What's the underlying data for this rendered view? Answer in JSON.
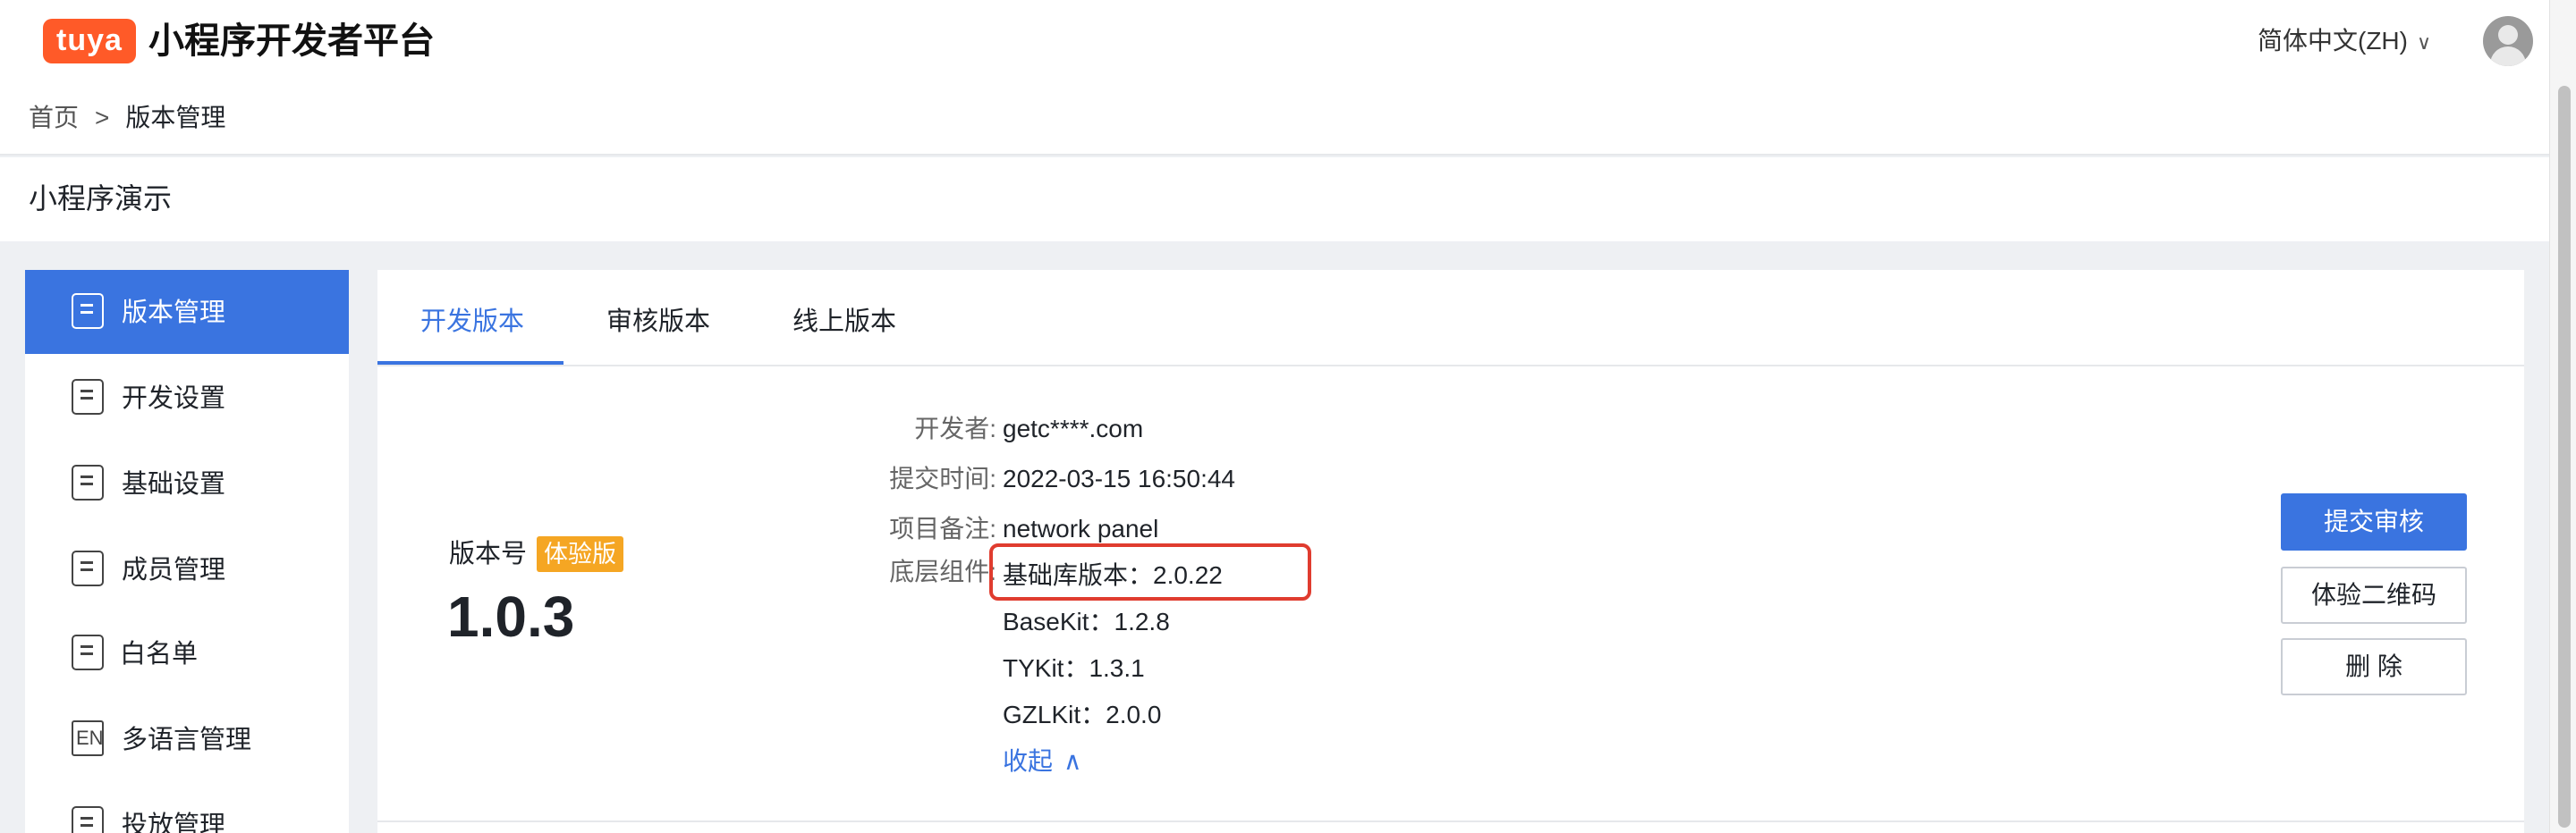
{
  "header": {
    "logo_text": "tuya",
    "platform_title": "小程序开发者平台",
    "language": "简体中文(ZH)",
    "language_chevron": "∨",
    "avatar_icon": "user-avatar-icon"
  },
  "breadcrumb": {
    "home": "首页",
    "separator": ">",
    "current": "版本管理"
  },
  "page": {
    "title": "小程序演示"
  },
  "sidebar": {
    "items": [
      {
        "label": "版本管理",
        "icon": "version-icon",
        "active": true
      },
      {
        "label": "开发设置",
        "icon": "dev-settings-icon",
        "active": false
      },
      {
        "label": "基础设置",
        "icon": "basic-settings-icon",
        "active": false
      },
      {
        "label": "成员管理",
        "icon": "member-icon",
        "active": false
      },
      {
        "label": "白名单",
        "icon": "whitelist-icon",
        "active": false
      },
      {
        "label": "多语言管理",
        "icon": "language-icon",
        "icon_text": "EN",
        "active": false
      },
      {
        "label": "投放管理",
        "icon": "delivery-icon",
        "active": false
      }
    ]
  },
  "tabs": [
    {
      "label": "开发版本",
      "active": true
    },
    {
      "label": "审核版本",
      "active": false
    },
    {
      "label": "线上版本",
      "active": false
    }
  ],
  "version": {
    "label": "版本号",
    "badge": "体验版",
    "number": "1.0.3"
  },
  "details": {
    "developer_key": "开发者:",
    "developer_value": "getc****.com",
    "submit_time_key": "提交时间:",
    "submit_time_value": "2022-03-15 16:50:44",
    "remark_key": "项目备注:",
    "remark_value": "network panel",
    "components_key": "底层组件:",
    "components": [
      "基础库版本：2.0.22",
      "BaseKit：1.2.8",
      "TYKit：1.3.1",
      "GZLKit：2.0.0"
    ],
    "collapse_label": "收起",
    "collapse_chevron": "∧"
  },
  "actions": {
    "submit_review": "提交审核",
    "qr_code": "体验二维码",
    "delete": "删 除"
  },
  "colors": {
    "accent": "#3a74e0",
    "brand": "#ff5a28",
    "badge": "#f5a623",
    "highlight": "#e03c2f"
  }
}
